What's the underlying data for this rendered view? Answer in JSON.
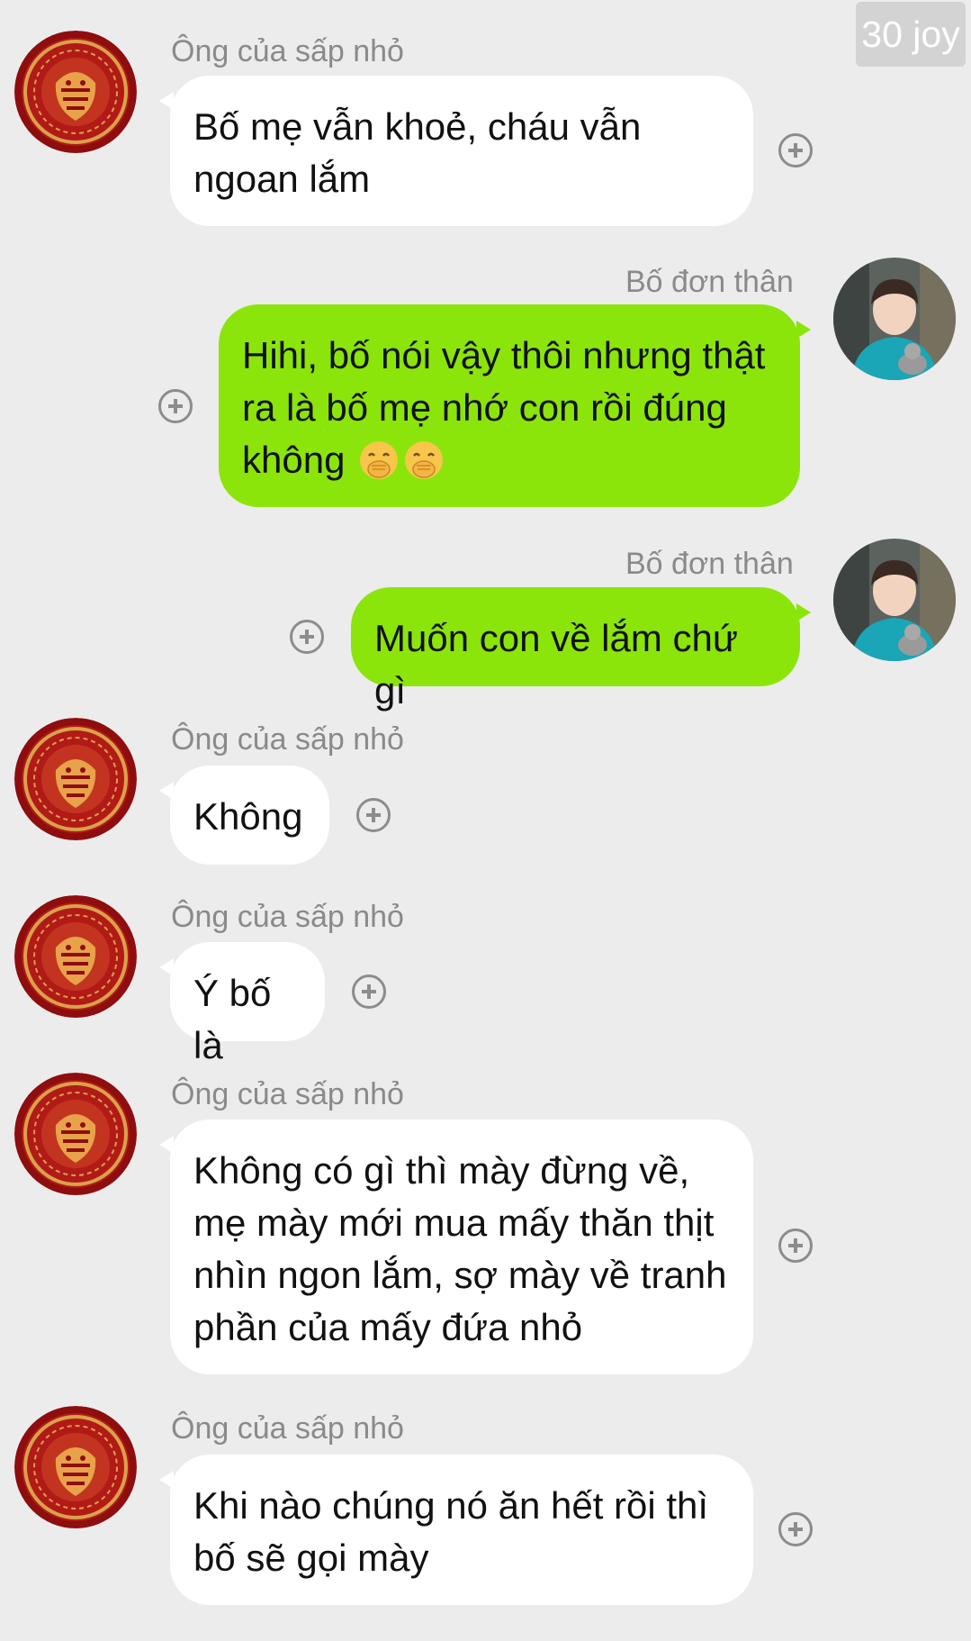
{
  "watermark": "30 joy",
  "contacts": {
    "grandpa": {
      "name": "Ông của sấp nhỏ",
      "avatar_icon": "tiger-medallion-avatar-icon"
    },
    "dad": {
      "name": "Bố đơn thân",
      "avatar_icon": "boy-with-cat-avatar-icon"
    }
  },
  "messages": [
    {
      "sender": "Ông của sấp nhỏ",
      "direction": "incoming",
      "lines": [
        "Bố mẹ vẫn khoẻ, cháu vẫn",
        "ngoan lắm"
      ]
    },
    {
      "sender": "Bố đơn thân",
      "direction": "outgoing",
      "lines": [
        "Hihi, bố nói vậy thôi nhưng thật",
        "ra là bố mẹ nhớ con rồi đúng",
        "không"
      ],
      "emoji": [
        "face-with-hand-over-mouth-icon",
        "face-with-hand-over-mouth-icon"
      ]
    },
    {
      "sender": "Bố đơn thân",
      "direction": "outgoing",
      "lines": [
        "Muốn con về lắm chứ gì"
      ]
    },
    {
      "sender": "Ông của sấp nhỏ",
      "direction": "incoming",
      "lines": [
        "Không"
      ]
    },
    {
      "sender": "Ông của sấp nhỏ",
      "direction": "incoming",
      "lines": [
        "Ý bố là"
      ]
    },
    {
      "sender": "Ông của sấp nhỏ",
      "direction": "incoming",
      "lines": [
        "Không có gì thì mày đừng về,",
        "mẹ mày mới mua mấy thăn thịt",
        "nhìn ngon lắm, sợ mày về tranh",
        "phần của mấy đứa nhỏ"
      ]
    },
    {
      "sender": "Ông của sấp nhỏ",
      "direction": "incoming",
      "lines": [
        "Khi nào chúng nó ăn hết rồi thì",
        "bố sẽ gọi mày"
      ]
    }
  ],
  "colors": {
    "background": "#ececec",
    "incoming_bubble": "#ffffff",
    "outgoing_bubble": "#8be50b",
    "sender_name": "#8a8a8a",
    "message_text": "#111111"
  }
}
